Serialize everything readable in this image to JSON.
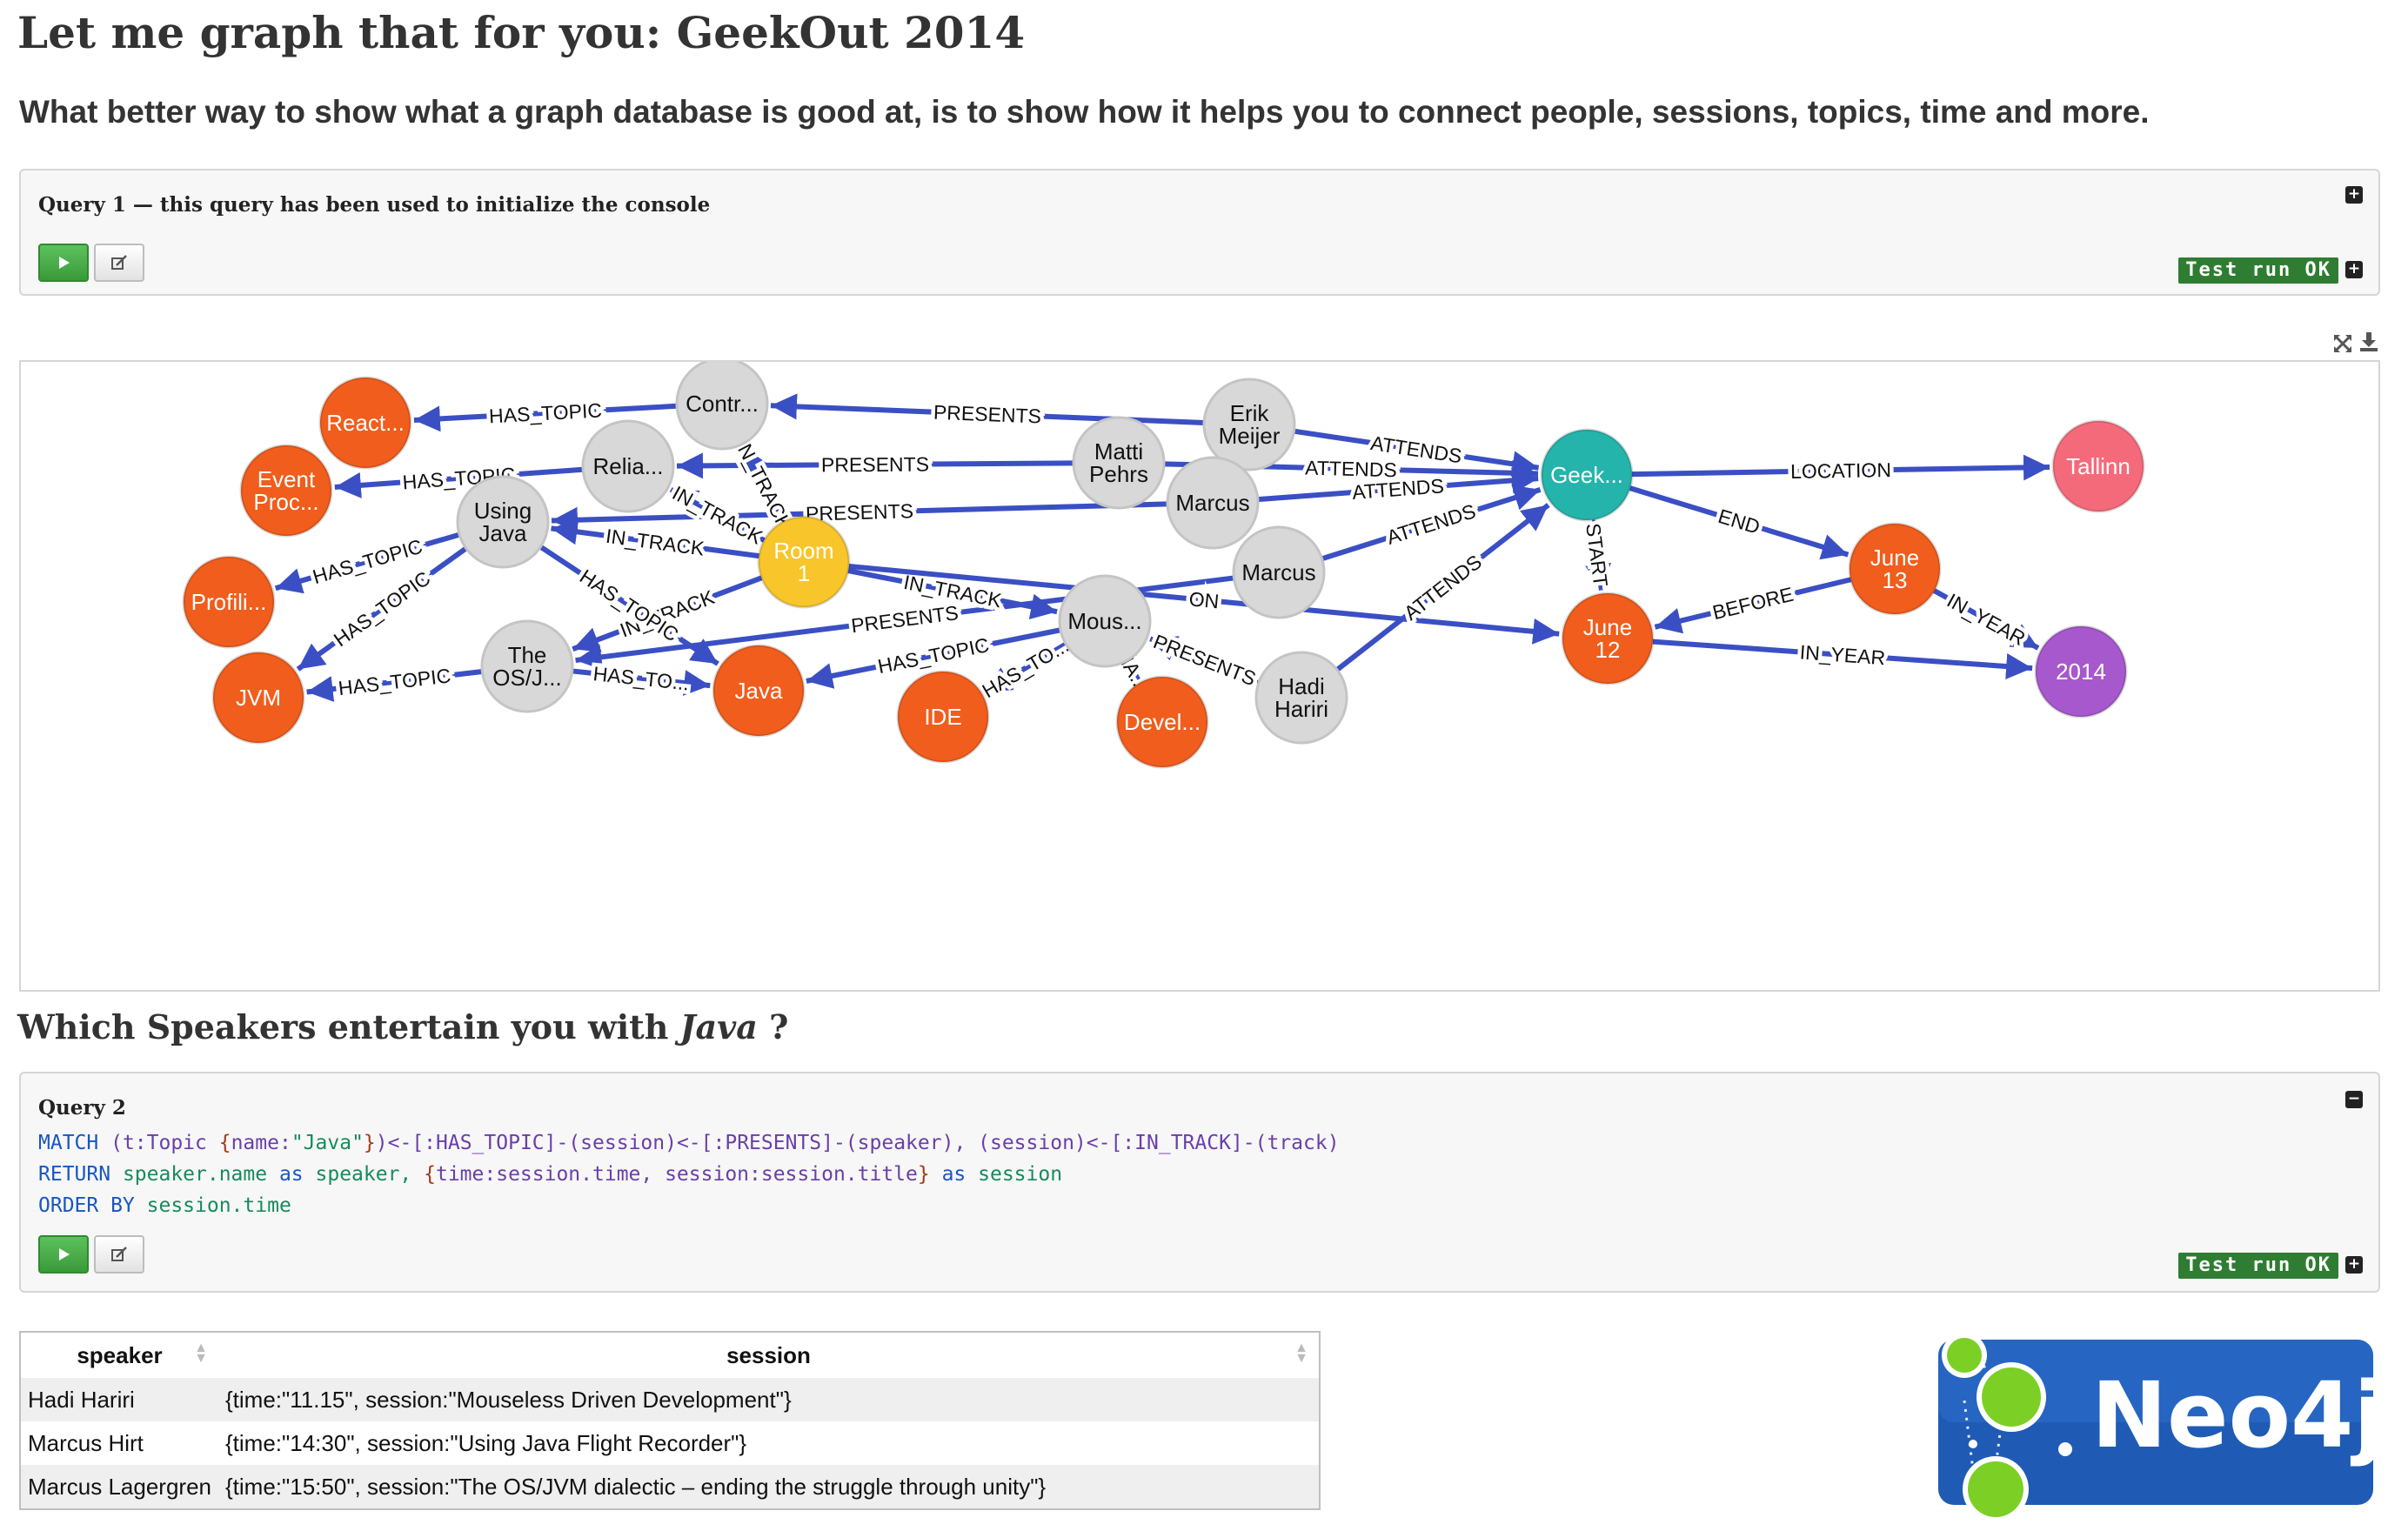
{
  "page": {
    "title": "Let me graph that for you: GeekOut 2014",
    "subtitle": "What better way to show what a graph database is good at, is to show how it helps you to connect people, sessions, topics, time and more."
  },
  "query1": {
    "title": "Query 1 — this query has been used to initialize the console",
    "status": "Test run OK",
    "expand_icon": "plus-square-icon"
  },
  "graph": {
    "toolbar_icons": [
      "fullscreen-icon",
      "download-icon"
    ],
    "colors": {
      "gray": "#d8d8d8",
      "orange": "#f05d1c",
      "yellow": "#f8c62b",
      "teal": "#25b4ab",
      "pink": "#f56a7a",
      "purple": "#a758cc",
      "edge": "#3b4fc4"
    },
    "nodes": [
      {
        "id": "react",
        "label": [
          "React..."
        ],
        "color": "orange"
      },
      {
        "id": "contr",
        "label": [
          "Contr..."
        ],
        "color": "gray"
      },
      {
        "id": "erik",
        "label": [
          "Erik",
          "Meijer"
        ],
        "color": "gray"
      },
      {
        "id": "event",
        "label": [
          "Event",
          "Proc..."
        ],
        "color": "orange"
      },
      {
        "id": "relia",
        "label": [
          "Relia..."
        ],
        "color": "gray"
      },
      {
        "id": "matti",
        "label": [
          "Matti",
          "Pehrs"
        ],
        "color": "gray"
      },
      {
        "id": "geek",
        "label": [
          "Geek..."
        ],
        "color": "teal"
      },
      {
        "id": "tallinn",
        "label": [
          "Tallinn"
        ],
        "color": "pink"
      },
      {
        "id": "usingjava",
        "label": [
          "Using",
          "Java"
        ],
        "color": "gray"
      },
      {
        "id": "marcus1",
        "label": [
          "Marcus"
        ],
        "color": "gray"
      },
      {
        "id": "profili",
        "label": [
          "Profili..."
        ],
        "color": "orange"
      },
      {
        "id": "room1",
        "label": [
          "Room",
          "1"
        ],
        "color": "yellow"
      },
      {
        "id": "marcus2",
        "label": [
          "Marcus"
        ],
        "color": "gray"
      },
      {
        "id": "june13",
        "label": [
          "June",
          "13"
        ],
        "color": "orange"
      },
      {
        "id": "jvm",
        "label": [
          "JVM"
        ],
        "color": "orange"
      },
      {
        "id": "theos",
        "label": [
          "The",
          "OS/J..."
        ],
        "color": "gray"
      },
      {
        "id": "java",
        "label": [
          "Java"
        ],
        "color": "orange"
      },
      {
        "id": "mous",
        "label": [
          "Mous..."
        ],
        "color": "gray"
      },
      {
        "id": "june12",
        "label": [
          "June",
          "12"
        ],
        "color": "orange"
      },
      {
        "id": "y2014",
        "label": [
          "2014"
        ],
        "color": "purple"
      },
      {
        "id": "ide",
        "label": [
          "IDE"
        ],
        "color": "orange"
      },
      {
        "id": "devel",
        "label": [
          "Devel..."
        ],
        "color": "orange"
      },
      {
        "id": "hadi",
        "label": [
          "Hadi",
          "Hariri"
        ],
        "color": "gray"
      }
    ],
    "edges": [
      {
        "from": "contr",
        "to": "react",
        "label": "HAS_TOPIC"
      },
      {
        "from": "erik",
        "to": "contr",
        "label": "PRESENTS"
      },
      {
        "from": "erik",
        "to": "geek",
        "label": "ATTENDS"
      },
      {
        "from": "relia",
        "to": "event",
        "label": "HAS_TOPIC"
      },
      {
        "from": "matti",
        "to": "relia",
        "label": "PRESENTS"
      },
      {
        "from": "matti",
        "to": "geek",
        "label": "ATTENDS"
      },
      {
        "from": "marcus1",
        "to": "usingjava",
        "label": "PRESENTS"
      },
      {
        "from": "marcus1",
        "to": "geek",
        "label": "ATTENDS"
      },
      {
        "from": "marcus2",
        "to": "geek",
        "label": "ATTENDS"
      },
      {
        "from": "marcus2",
        "to": "theos",
        "label": "PRESENTS"
      },
      {
        "from": "geek",
        "to": "tallinn",
        "label": "LOCATION"
      },
      {
        "from": "geek",
        "to": "june13",
        "label": "END"
      },
      {
        "from": "geek",
        "to": "june12",
        "label": "START"
      },
      {
        "from": "june13",
        "to": "june12",
        "label": "BEFORE"
      },
      {
        "from": "june13",
        "to": "y2014",
        "label": "IN_YEAR"
      },
      {
        "from": "june12",
        "to": "y2014",
        "label": "IN_YEAR"
      },
      {
        "from": "room1",
        "to": "contr",
        "label": "IN_TRACK"
      },
      {
        "from": "room1",
        "to": "relia",
        "label": "IN_TRACK"
      },
      {
        "from": "room1",
        "to": "usingjava",
        "label": "IN_TRACK"
      },
      {
        "from": "room1",
        "to": "mous",
        "label": "IN_TRACK"
      },
      {
        "from": "room1",
        "to": "theos",
        "label": "IN_TRACK"
      },
      {
        "from": "room1",
        "to": "june12",
        "label": "ON"
      },
      {
        "from": "usingjava",
        "to": "profili",
        "label": "HAS_TOPIC"
      },
      {
        "from": "usingjava",
        "to": "jvm",
        "label": "HAS_TOPIC"
      },
      {
        "from": "usingjava",
        "to": "java",
        "label": "HAS_TOPIC"
      },
      {
        "from": "theos",
        "to": "jvm",
        "label": "HAS_TOPIC"
      },
      {
        "from": "theos",
        "to": "java",
        "label": "HAS_TO..."
      },
      {
        "from": "mous",
        "to": "java",
        "label": "HAS_TOPIC"
      },
      {
        "from": "mous",
        "to": "ide",
        "label": "HAS_TO..."
      },
      {
        "from": "mous",
        "to": "devel",
        "label": "HA..."
      },
      {
        "from": "hadi",
        "to": "mous",
        "label": "PRESENTS"
      },
      {
        "from": "hadi",
        "to": "geek",
        "label": "ATTENDS"
      }
    ]
  },
  "section2": {
    "heading_prefix": "Which Speakers entertain you with ",
    "heading_em": "Java",
    "heading_suffix": " ?"
  },
  "query2": {
    "title": "Query 2",
    "collapse_icon": "minus-square-icon",
    "status": "Test run OK",
    "code": [
      [
        {
          "c": "kw",
          "t": "MATCH "
        },
        {
          "c": "tx",
          "t": "(t:Topic "
        },
        {
          "c": "br",
          "t": "{"
        },
        {
          "c": "tx",
          "t": "name:"
        },
        {
          "c": "st",
          "t": "\"Java\""
        },
        {
          "c": "br",
          "t": "}"
        },
        {
          "c": "tx",
          "t": ")<-[:HAS_TOPIC]-(session)<-[:PRESENTS]-(speaker), (session)<-[:IN_TRACK]-(track)"
        }
      ],
      [
        {
          "c": "kw",
          "t": "RETURN "
        },
        {
          "c": "st",
          "t": "speaker.name "
        },
        {
          "c": "kw",
          "t": "as "
        },
        {
          "c": "st",
          "t": "speaker, "
        },
        {
          "c": "br",
          "t": "{"
        },
        {
          "c": "tx",
          "t": "time:session.time, session:session.title"
        },
        {
          "c": "br",
          "t": "} "
        },
        {
          "c": "kw",
          "t": "as "
        },
        {
          "c": "st",
          "t": "session"
        }
      ],
      [
        {
          "c": "kw",
          "t": "ORDER BY "
        },
        {
          "c": "st",
          "t": "session.time"
        }
      ]
    ]
  },
  "results": {
    "columns": [
      "speaker",
      "session"
    ],
    "rows": [
      [
        "Hadi Hariri",
        "{time:\"11.15\", session:\"Mouseless Driven Development\"}"
      ],
      [
        "Marcus Hirt",
        "{time:\"14:30\", session:\"Using Java Flight Recorder\"}"
      ],
      [
        "Marcus Lagergren",
        "{time:\"15:50\", session:\"The OS/JVM dialectic – ending the struggle through unity\"}"
      ]
    ]
  },
  "logo": {
    "text": "Neo4j",
    "bg": "#1f5bb5",
    "dot": "#7ccf25"
  }
}
